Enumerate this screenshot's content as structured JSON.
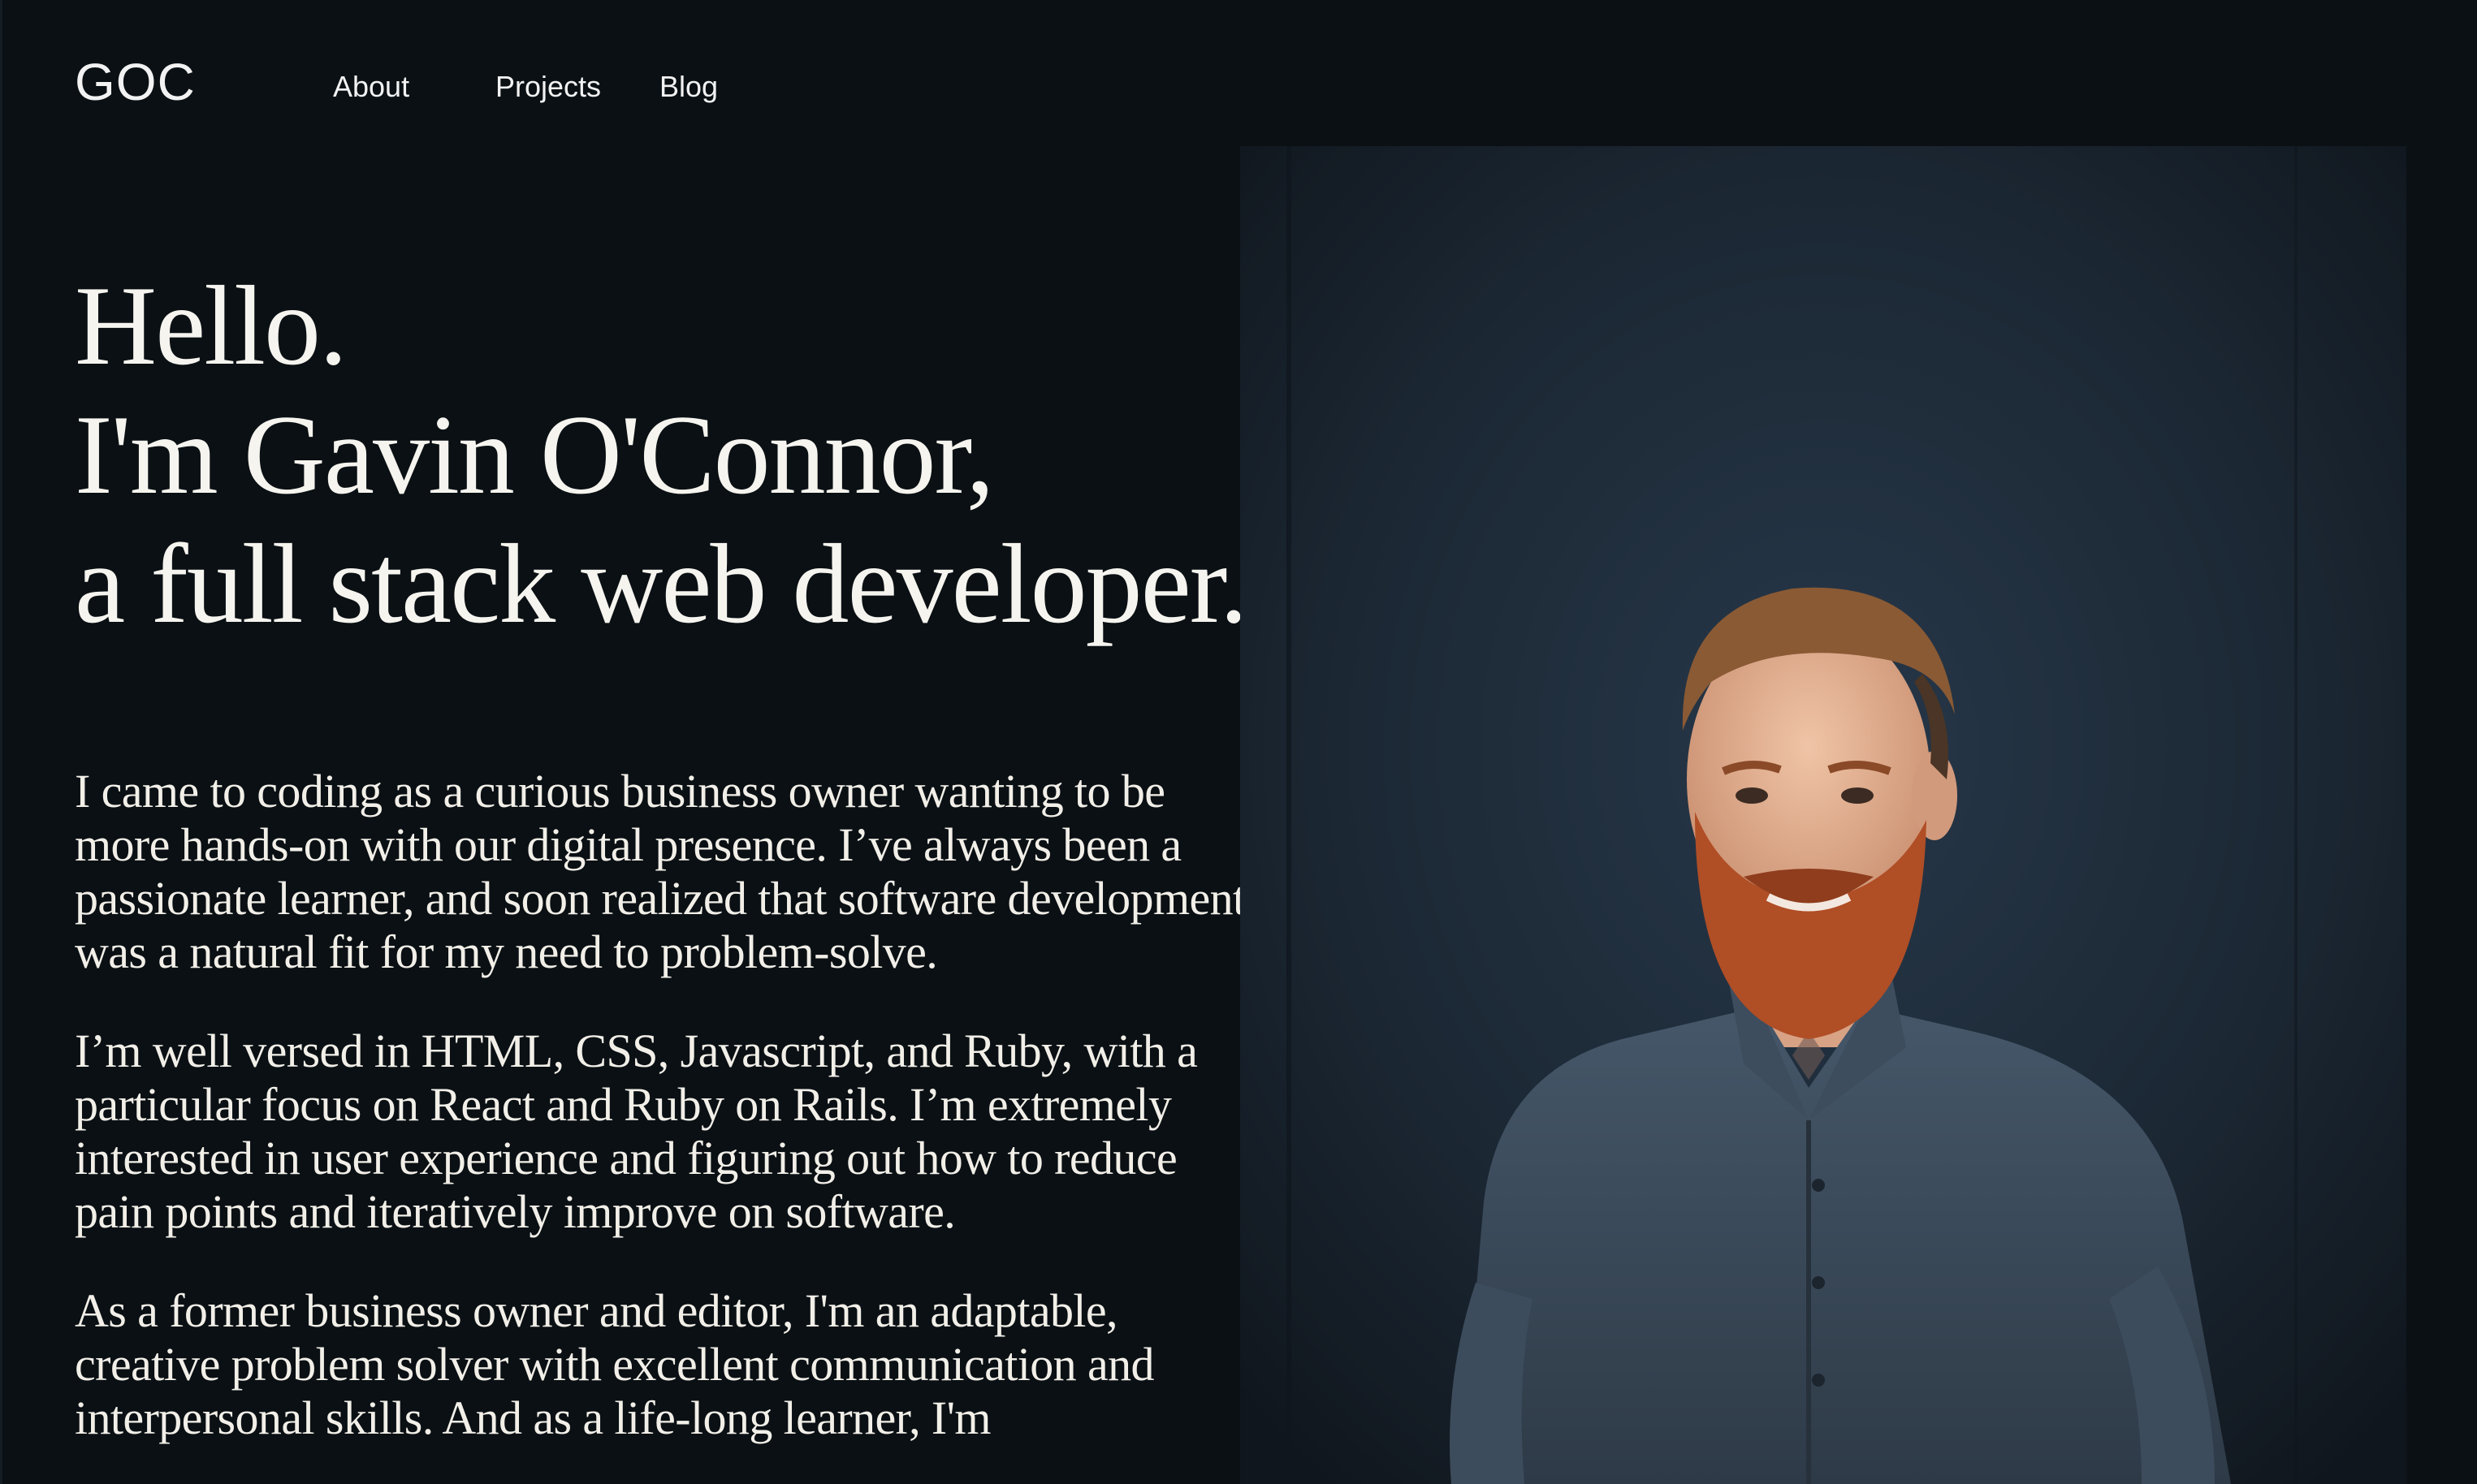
{
  "nav": {
    "logo": "GOC",
    "items": [
      {
        "label": "About"
      },
      {
        "label": "Projects"
      },
      {
        "label": "Blog"
      }
    ]
  },
  "hero": {
    "line1": "Hello.",
    "line2": "I'm Gavin O'Connor,",
    "line3": "a full stack web developer."
  },
  "bio": {
    "paragraphs": [
      "I came to coding as a curious business owner wanting to be more hands-on with our digital presence. I’ve always been a passionate learner, and soon realized that software development was a natural fit for my need to problem-solve.",
      "I’m well versed in HTML, CSS, Javascript, and Ruby, with a particular focus on React and Ruby on Rails. I’m extremely interested in user experience and figuring out how to reduce pain points and iteratively improve on software.",
      "As a former business owner and editor, I'm an adaptable, creative problem solver with excellent communication and interpersonal skills. And as a life-long learner, I'm"
    ]
  },
  "colors": {
    "background": "#0a1014",
    "text": "#f4f1ea",
    "photo_backdrop": "#1a2430",
    "shirt": "#3a4a5a",
    "beard": "#b5532a",
    "hair": "#8a5a34"
  },
  "photo": {
    "icon": "portrait-photo"
  }
}
